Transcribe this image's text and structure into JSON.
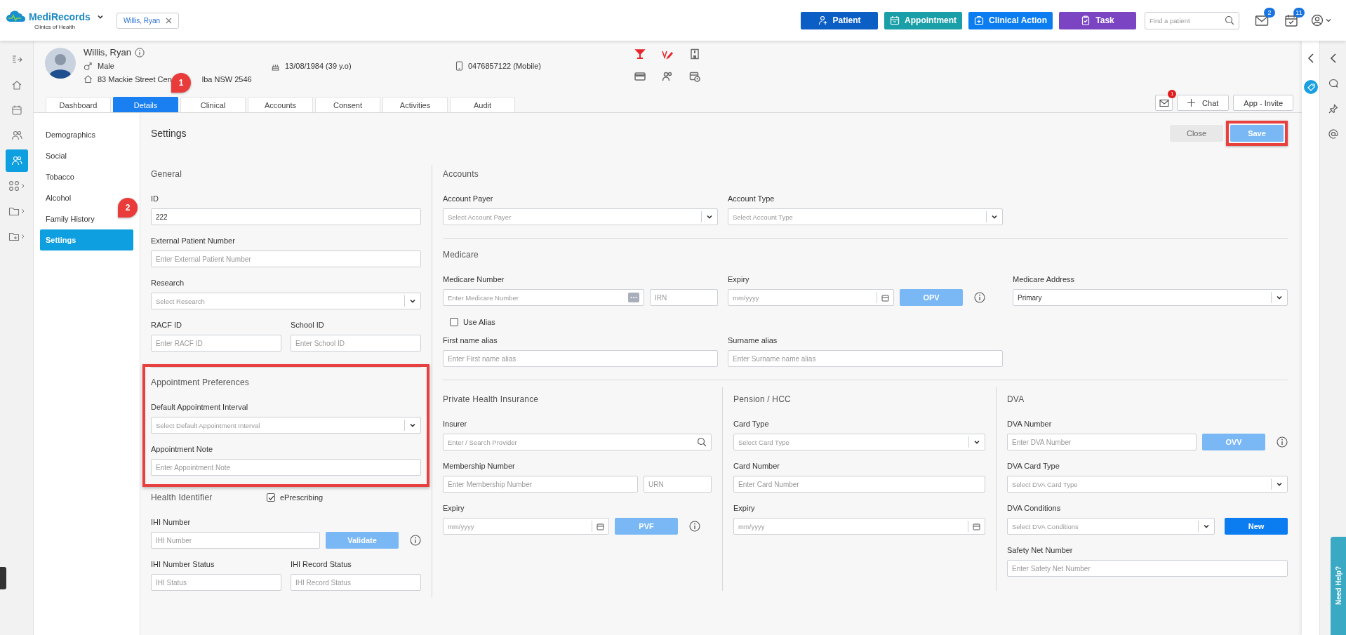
{
  "app": {
    "brand": "MediRecords",
    "clinic": "Clinics of Health"
  },
  "open_patient": {
    "label": "Willis, Ryan"
  },
  "actions": [
    {
      "kind": "patient",
      "label": "Patient",
      "color": "#0b5ec4"
    },
    {
      "kind": "appointment",
      "label": "Appointment",
      "color": "#1a9fa8"
    },
    {
      "kind": "clinical",
      "label": "Clinical Action",
      "color": "#0b7df0"
    },
    {
      "kind": "task",
      "label": "Task",
      "color": "#7a44c2"
    }
  ],
  "patient_search": {
    "placeholder": "Find a patient"
  },
  "notifications": [
    {
      "kind": "mail",
      "count": "2"
    },
    {
      "kind": "tasks",
      "count": "11"
    }
  ],
  "left_rail": [
    {
      "kind": "collapse",
      "selected": false,
      "expandable": false
    },
    {
      "kind": "home",
      "selected": false,
      "expandable": false
    },
    {
      "kind": "calendar",
      "selected": false,
      "expandable": false
    },
    {
      "kind": "network",
      "selected": false,
      "expandable": false
    },
    {
      "kind": "patients",
      "selected": true,
      "expandable": false
    },
    {
      "kind": "apps",
      "selected": false,
      "expandable": true
    },
    {
      "kind": "folder",
      "selected": false,
      "expandable": true
    },
    {
      "kind": "folder-add",
      "selected": false,
      "expandable": true
    }
  ],
  "patient": {
    "name": "Willis, Ryan",
    "gender": "Male",
    "address_parts": [
      "83 Mackie Street Cen",
      "lba NSW 2546"
    ],
    "dob": "13/08/1984 (39 y.o)",
    "phone": "0476857122 (Mobile)",
    "alerts": [
      {
        "kind": "cocktail",
        "color": "#e5262b"
      },
      {
        "kind": "pen",
        "color": "#e5262b"
      },
      {
        "kind": "building",
        "color": "#6b6b6b"
      },
      {
        "kind": "card",
        "color": "#6b6b6b"
      },
      {
        "kind": "people",
        "color": "#6b6b6b"
      },
      {
        "kind": "calendar-clock",
        "color": "#6b6b6b"
      }
    ]
  },
  "tabs": [
    {
      "label": "Dashboard",
      "selected": false
    },
    {
      "label": "Details",
      "selected": true
    },
    {
      "label": "Clinical",
      "selected": false
    },
    {
      "label": "Accounts",
      "selected": false
    },
    {
      "label": "Consent",
      "selected": false
    },
    {
      "label": "Activities",
      "selected": false
    },
    {
      "label": "Audit",
      "selected": false
    }
  ],
  "header_actions": {
    "messages": "1",
    "chat": "Chat",
    "invite": "App - Invite"
  },
  "sub_nav": [
    {
      "label": "Demographics",
      "selected": false
    },
    {
      "label": "Social",
      "selected": false
    },
    {
      "label": "Tobacco",
      "selected": false
    },
    {
      "label": "Alcohol",
      "selected": false
    },
    {
      "label": "Family History",
      "selected": false
    },
    {
      "label": "Settings",
      "selected": true
    }
  ],
  "page": {
    "title": "Settings",
    "close": "Close",
    "save": {
      "label": "Save",
      "highlighted": true
    }
  },
  "general": {
    "title": "General",
    "fields": [
      {
        "label": "ID",
        "kind": "text",
        "value": "222"
      },
      {
        "label": "External Patient Number",
        "kind": "text",
        "placeholder": "Enter External Patient Number"
      },
      {
        "label": "Research",
        "kind": "select",
        "placeholder": "Select Research"
      },
      {
        "label": "RACF ID",
        "kind": "text",
        "placeholder": "Enter RACF ID"
      },
      {
        "label": "School ID",
        "kind": "text",
        "placeholder": "Enter School ID"
      }
    ]
  },
  "appointment_preferences": {
    "title": "Appointment Preferences",
    "highlighted": true,
    "fields": [
      {
        "label": "Default Appointment Interval",
        "kind": "select",
        "placeholder": "Select Default Appointment Interval"
      },
      {
        "label": "Appointment Note",
        "kind": "text",
        "placeholder": "Enter Appointment Note"
      }
    ]
  },
  "health_identifier": {
    "title": "Health Identifier",
    "eprescribing": {
      "label": "ePrescribing",
      "checked": true
    },
    "validate": "Validate",
    "fields": [
      {
        "label": "IHI Number",
        "kind": "text",
        "placeholder": "IHI Number"
      },
      {
        "label": "IHI Number Status",
        "kind": "text",
        "placeholder": "IHI Status"
      },
      {
        "label": "IHI Record Status",
        "kind": "text",
        "placeholder": "IHI Record Status"
      }
    ]
  },
  "accounts": {
    "title": "Accounts",
    "fields": [
      {
        "label": "Account Payer",
        "kind": "select",
        "placeholder": "Select Account Payer"
      },
      {
        "label": "Account Type",
        "kind": "select",
        "placeholder": "Select Account Type"
      }
    ]
  },
  "medicare": {
    "title": "Medicare",
    "opv": "OPV",
    "fields": [
      {
        "label": "Medicare Number",
        "kind": "number",
        "placeholder": "Enter Medicare Number"
      },
      {
        "kind": "text",
        "placeholder": "IRN"
      },
      {
        "label": "Expiry",
        "kind": "date",
        "placeholder": "mm/yyyy"
      },
      {
        "label": "Medicare Address",
        "kind": "select",
        "value": "Primary"
      }
    ],
    "use_alias": {
      "label": "Use Alias",
      "checked": false
    },
    "alias_fields": [
      {
        "label": "First name alias",
        "kind": "text",
        "placeholder": "Enter First name alias"
      },
      {
        "label": "Surname alias",
        "kind": "text",
        "placeholder": "Enter Surname name alias"
      }
    ]
  },
  "private_health": {
    "title": "Private Health Insurance",
    "pvf": "PVF",
    "fields": [
      {
        "label": "Insurer",
        "kind": "search",
        "placeholder": "Enter / Search Provider"
      },
      {
        "label": "Membership Number",
        "kind": "text",
        "placeholder": "Enter Membership Number"
      },
      {
        "kind": "text",
        "placeholder": "URN"
      },
      {
        "label": "Expiry",
        "kind": "date",
        "placeholder": "mm/yyyy"
      }
    ]
  },
  "pension": {
    "title": "Pension / HCC",
    "fields": [
      {
        "label": "Card Type",
        "kind": "select",
        "placeholder": "Select Card Type"
      },
      {
        "label": "Card Number",
        "kind": "text",
        "placeholder": "Enter Card Number"
      },
      {
        "label": "Expiry",
        "kind": "date",
        "placeholder": "mm/yyyy"
      }
    ]
  },
  "dva": {
    "title": "DVA",
    "ovv": "OVV",
    "new": "New",
    "fields": [
      {
        "label": "DVA Number",
        "kind": "text",
        "placeholder": "Enter DVA Number"
      },
      {
        "label": "DVA Card Type",
        "kind": "select",
        "placeholder": "Select DVA Card Type"
      },
      {
        "label": "DVA Conditions",
        "kind": "select",
        "placeholder": "Select DVA Conditions"
      },
      {
        "label": "Safety Net Number",
        "kind": "text",
        "placeholder": "Enter Safety Net Number"
      }
    ]
  },
  "callouts": [
    {
      "label": "1"
    },
    {
      "label": "2"
    }
  ],
  "help": {
    "label": "Need Help?"
  }
}
